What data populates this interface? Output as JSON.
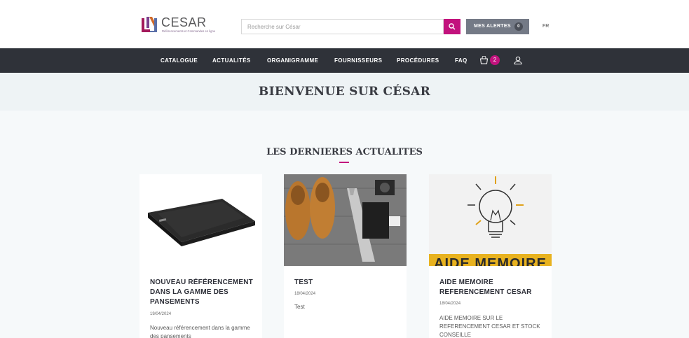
{
  "header": {
    "logo_title": "CESAR",
    "logo_subtitle": "Référencements et Commandes en ligne",
    "search_placeholder": "Recherche sur César",
    "alerts_label": "MES ALERTES",
    "alerts_count": "0",
    "language": "FR"
  },
  "nav": {
    "items": [
      "CATALOGUE",
      "ACTUALITÉS",
      "ORGANIGRAMME",
      "FOURNISSEURS",
      "PROCÉDURES",
      "FAQ"
    ],
    "cart_count": "2"
  },
  "welcome_title": "BIENVENUE SUR CÉSAR",
  "news": {
    "section_title": "LES DERNIERES ACTUALITES",
    "cards": [
      {
        "title": "NOUVEAU RÉFÉRENCEMENT DANS LA GAMME DES PANSEMENTS",
        "date": "19/04/2024",
        "excerpt": "Nouveau référencement dans la gamme des pansements"
      },
      {
        "title": "TEST",
        "date": "18/04/2024",
        "excerpt": "Test"
      },
      {
        "title": "AIDE MEMOIRE REFERENCEMENT CESAR",
        "date": "18/04/2024",
        "excerpt": "AIDE MEMOIRE SUR LE REFERENCEMENT CESAR ET STOCK CONSEILLE",
        "image_banner_text": "AIDE MEMOIRE"
      }
    ]
  },
  "colors": {
    "accent": "#c2127d",
    "navbar": "#2f3239",
    "alerts_button": "#747a86"
  }
}
